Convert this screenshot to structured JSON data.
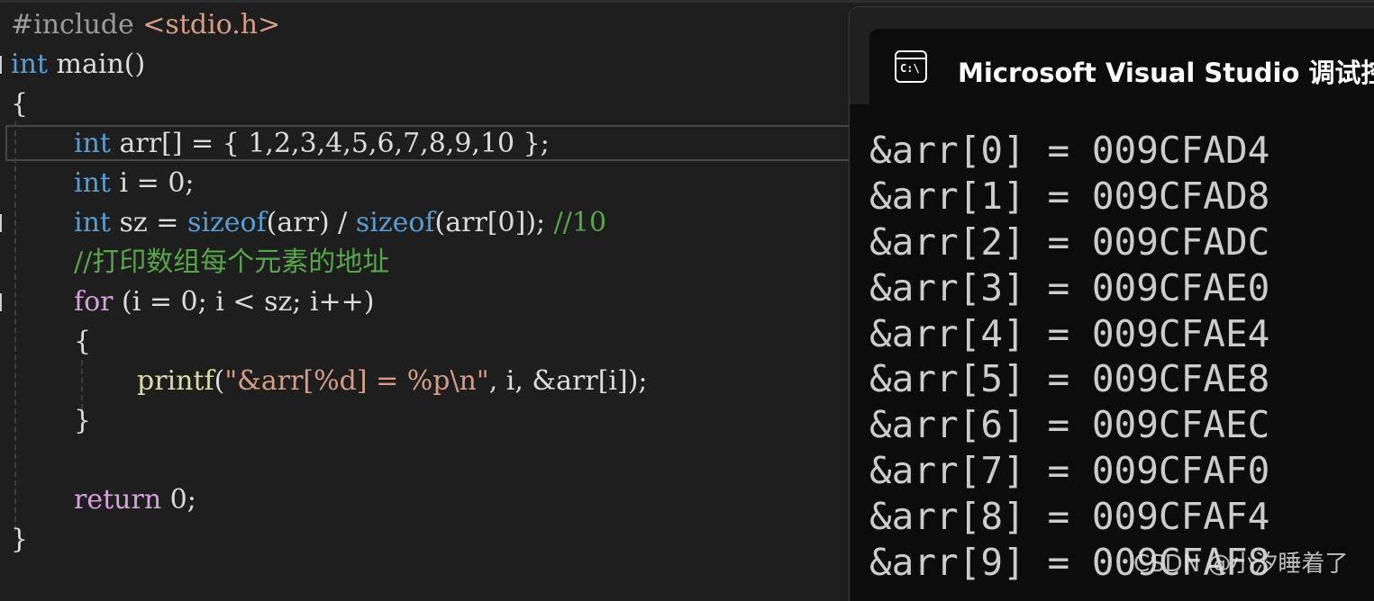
{
  "editor": {
    "line_1": {
      "directive": "#include",
      "header": "<stdio.h>"
    },
    "line_2": {
      "type": "int",
      "name": "main()"
    },
    "line_3": {
      "brace": "{"
    },
    "line_4": {
      "type": "int",
      "decl": "arr[] = { 1,2,3,4,5,6,7,8,9,10 };"
    },
    "line_5": {
      "type": "int",
      "decl": "i = 0;"
    },
    "line_6": {
      "type": "int",
      "pre": "sz = ",
      "fn1": "sizeof",
      "mid": "(arr) / ",
      "fn2": "sizeof",
      "post": "(arr[0]);",
      "comment": " //10"
    },
    "line_7": {
      "comment": "//打印数组每个元素的地址"
    },
    "line_8": {
      "keyword": "for",
      "rest": " (i = 0; i < sz; i++)"
    },
    "line_9": {
      "brace": "{"
    },
    "line_10": {
      "fn": "printf",
      "open": "(",
      "str": "\"&arr[%d] = %p\\n\"",
      "rest": ", i, &arr[i]);"
    },
    "line_11": {
      "brace": "}"
    },
    "line_13": {
      "keyword": "return",
      "rest": " 0;"
    },
    "line_14": {
      "brace": "}"
    }
  },
  "console": {
    "icon_text": "C:\\",
    "title": "Microsoft Visual Studio 调试控",
    "output": [
      "&arr[0] = 009CFAD4",
      "&arr[1] = 009CFAD8",
      "&arr[2] = 009CFADC",
      "&arr[3] = 009CFAE0",
      "&arr[4] = 009CFAE4",
      "&arr[5] = 009CFAE8",
      "&arr[6] = 009CFAEC",
      "&arr[7] = 009CFAF0",
      "&arr[8] = 009CFAF4",
      "&arr[9] = 009CFAF8"
    ]
  },
  "watermark": "CSDN @小汐睡着了",
  "colors": {
    "editor_bg": "#1e1e1e",
    "keyword": "#569cd6",
    "control_keyword": "#d8a0df",
    "function": "#dcdcaa",
    "string": "#d69d85",
    "comment": "#57a64a",
    "console_bg": "#0c0c0c"
  }
}
